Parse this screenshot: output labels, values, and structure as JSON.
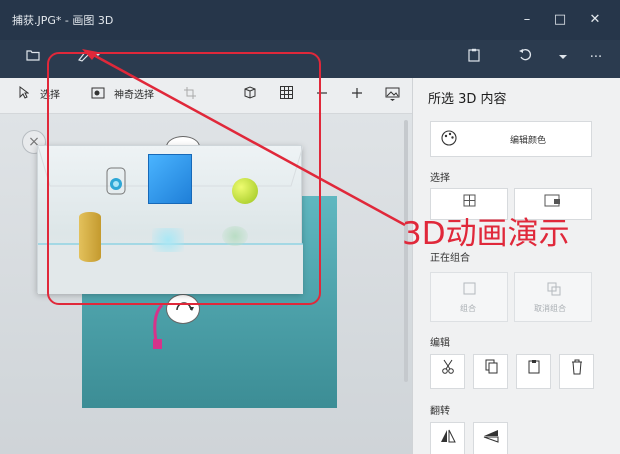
{
  "window": {
    "title": "捕获.JPG* - 画图 3D",
    "min_label": "–",
    "max_label": "□",
    "close_label": "✕"
  },
  "toolbar": {
    "menu_icon": "folder-icon",
    "brush_icon": "brush-icon",
    "paste_icon": "paste-icon",
    "undo_icon": "undo-icon",
    "more_label": "···"
  },
  "subbar": {
    "select_label": "选择",
    "magic_select_label": "神奇选择"
  },
  "panel": {
    "title": "所选 3D 内容",
    "edit_color_label": "编辑颜色",
    "select_section": "选择",
    "grouping_section": "正在组合",
    "group_label": "组合",
    "ungroup_label": "取消组合",
    "edit_section": "编辑",
    "flip_section": "翻转"
  },
  "annotation": {
    "text": "3D动画演示"
  },
  "colors": {
    "annotation": "#e0283a",
    "titlebar": "#26364a",
    "toolbar": "#2b3b4f",
    "panel": "#f0f1f2"
  }
}
